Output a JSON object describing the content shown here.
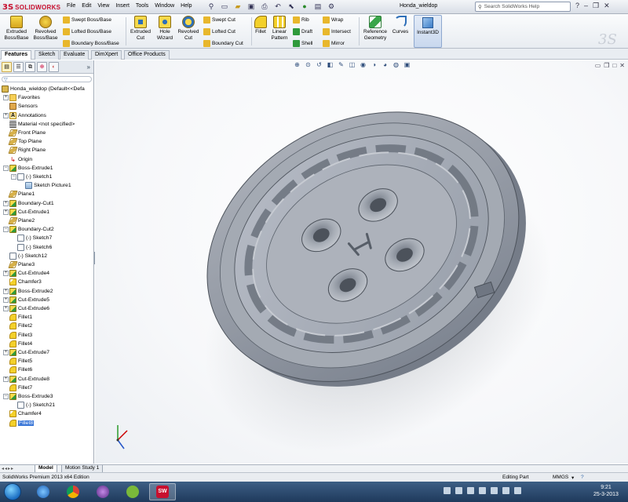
{
  "app": {
    "brand": "SOLIDWORKS",
    "document_title": "Honda_wieldop",
    "search_placeholder": "Search SolidWorks Help",
    "menus": [
      "File",
      "Edit",
      "View",
      "Insert",
      "Tools",
      "Window",
      "Help"
    ],
    "colors": {
      "brand_red": "#c8102e",
      "selection_blue": "#3875d7"
    }
  },
  "ribbon": {
    "extruded_boss": "Extruded Boss/Base",
    "revolved_boss": "Revolved Boss/Base",
    "swept_boss": "Swept Boss/Base",
    "lofted_boss": "Lofted Boss/Base",
    "boundary_boss": "Boundary Boss/Base",
    "extruded_cut": "Extruded Cut",
    "hole_wizard": "Hole Wizard",
    "revolved_cut": "Revolved Cut",
    "swept_cut": "Swept Cut",
    "lofted_cut": "Lofted Cut",
    "boundary_cut": "Boundary Cut",
    "fillet": "Fillet",
    "linear_pattern": "Linear Pattern",
    "rib": "Rib",
    "draft": "Draft",
    "shell": "Shell",
    "wrap": "Wrap",
    "intersect": "Intersect",
    "mirror": "Mirror",
    "reference_geometry": "Reference Geometry",
    "curves": "Curves",
    "instant3d": "Instant3D"
  },
  "cm_tabs": [
    "Features",
    "Sketch",
    "Evaluate",
    "DimXpert",
    "Office Products"
  ],
  "tree": {
    "root": "Honda_wieldop  (Default<<Defa",
    "items": [
      {
        "label": "Favorites",
        "icon": "folder-icon"
      },
      {
        "label": "Sensors",
        "icon": "sensor-icon"
      },
      {
        "label": "Annotations",
        "icon": "annotation-icon"
      },
      {
        "label": "Material <not specified>",
        "icon": "material-icon"
      },
      {
        "label": "Front Plane",
        "icon": "plane-icon"
      },
      {
        "label": "Top Plane",
        "icon": "plane-icon"
      },
      {
        "label": "Right Plane",
        "icon": "plane-icon"
      },
      {
        "label": "Origin",
        "icon": "origin-icon"
      },
      {
        "label": "Boss-Extrude1",
        "icon": "boss-extrude-icon"
      },
      {
        "label": "(-) Sketch1",
        "icon": "sketch-icon"
      },
      {
        "label": "Sketch Picture1",
        "icon": "sketch-picture-icon"
      },
      {
        "label": "Plane1",
        "icon": "plane-icon"
      },
      {
        "label": "Boundary-Cut1",
        "icon": "boundary-cut-icon"
      },
      {
        "label": "Cut-Extrude1",
        "icon": "cut-extrude-icon"
      },
      {
        "label": "Plane2",
        "icon": "plane-icon"
      },
      {
        "label": "Boundary-Cut2",
        "icon": "boundary-cut-icon"
      },
      {
        "label": "(-) Sketch7",
        "icon": "sketch-icon"
      },
      {
        "label": "(-) Sketch6",
        "icon": "sketch-icon"
      },
      {
        "label": "(-) Sketch12",
        "icon": "sketch-icon"
      },
      {
        "label": "Plane3",
        "icon": "plane-icon"
      },
      {
        "label": "Cut-Extrude4",
        "icon": "cut-extrude-icon"
      },
      {
        "label": "Chamfer3",
        "icon": "chamfer-icon"
      },
      {
        "label": "Boss-Extrude2",
        "icon": "boss-extrude-icon"
      },
      {
        "label": "Cut-Extrude5",
        "icon": "cut-extrude-icon"
      },
      {
        "label": "Cut-Extrude6",
        "icon": "cut-extrude-icon"
      },
      {
        "label": "Fillet1",
        "icon": "fillet-icon"
      },
      {
        "label": "Fillet2",
        "icon": "fillet-icon"
      },
      {
        "label": "Fillet3",
        "icon": "fillet-icon"
      },
      {
        "label": "Fillet4",
        "icon": "fillet-icon"
      },
      {
        "label": "Cut-Extrude7",
        "icon": "cut-extrude-icon"
      },
      {
        "label": "Fillet5",
        "icon": "fillet-icon"
      },
      {
        "label": "Fillet6",
        "icon": "fillet-icon"
      },
      {
        "label": "Cut-Extrude8",
        "icon": "cut-extrude-icon"
      },
      {
        "label": "Fillet7",
        "icon": "fillet-icon"
      },
      {
        "label": "Boss-Extrude3",
        "icon": "boss-extrude-icon"
      },
      {
        "label": "(-) Sketch21",
        "icon": "sketch-icon"
      },
      {
        "label": "Chamfer4",
        "icon": "chamfer-icon"
      },
      {
        "label": "Fillet8",
        "icon": "fillet-icon",
        "selected": true
      }
    ]
  },
  "bottom_tabs": [
    "Model",
    "Motion Study 1"
  ],
  "status": {
    "edition": "SolidWorks Premium 2013 x64 Edition",
    "mode": "Editing Part",
    "units": "MMGS"
  },
  "taskbar": {
    "time": "9:21",
    "date": "25-3-2013",
    "apps": [
      "internet-explorer-icon",
      "chrome-icon",
      "media-player-icon",
      "spotify-icon",
      "solidworks-taskbar-icon",
      "solidworks-app-icon",
      "file-explorer-icon"
    ]
  }
}
